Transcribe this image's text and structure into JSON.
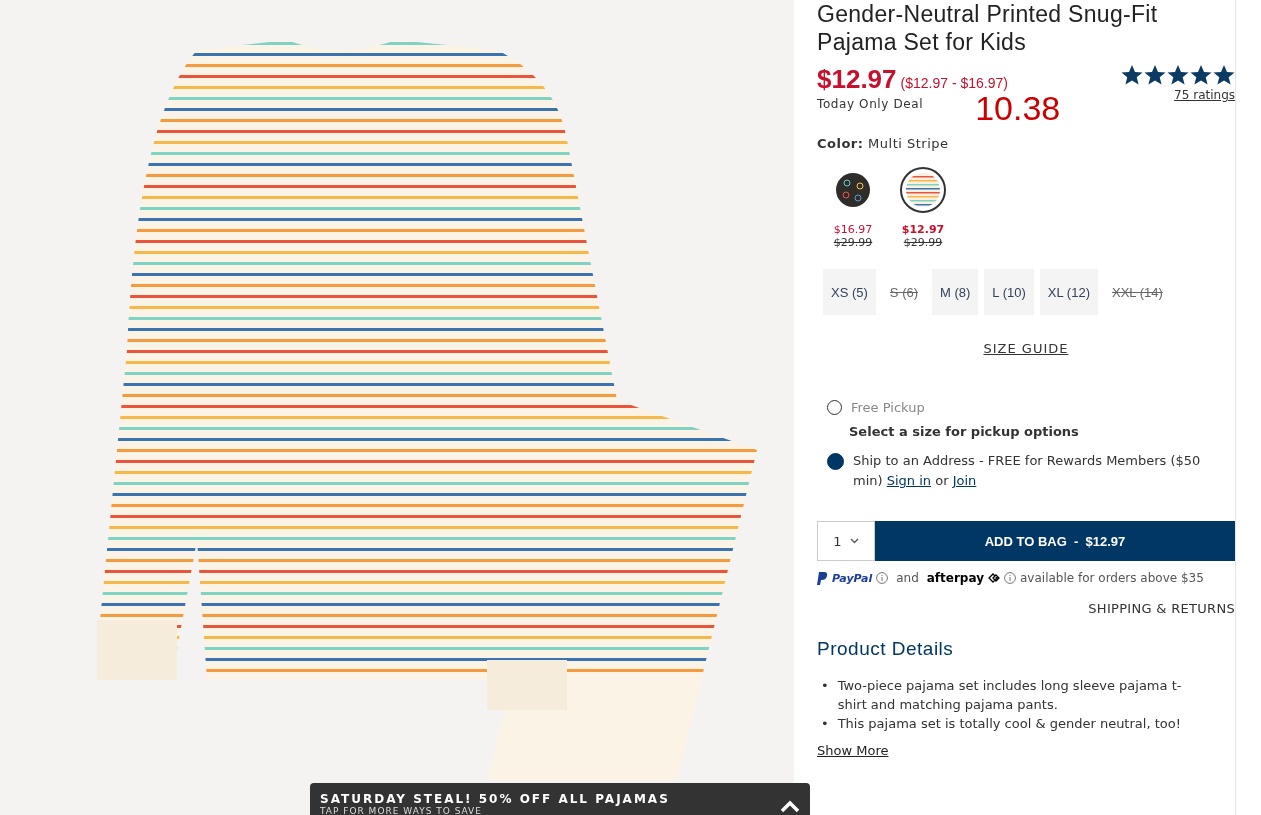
{
  "product_image": {
    "kind": "striped-pajamas"
  },
  "product": {
    "title": "Gender-Neutral Printed Snug-Fit Pajama Set for Kids",
    "price": "$12.97",
    "price_range": "($12.97 - $16.97)",
    "deal": "Today Only Deal",
    "overlay_price": "10.38",
    "rating": {
      "stars": 5,
      "label": "75 ratings"
    }
  },
  "color": {
    "label": "Color:",
    "value": "Multi Stripe",
    "swatches": [
      {
        "kind": "dark-print",
        "selected": false,
        "sale_price": "$16.97",
        "original_price": "$29.99"
      },
      {
        "kind": "stripe",
        "selected": true,
        "sale_price": "$12.97",
        "original_price": "$29.99"
      }
    ]
  },
  "sizes": [
    {
      "label": "XS (5)",
      "available": true
    },
    {
      "label": "S (6)",
      "available": false
    },
    {
      "label": "M (8)",
      "available": true
    },
    {
      "label": "L (10)",
      "available": true
    },
    {
      "label": "XL (12)",
      "available": true
    },
    {
      "label": "XXL (14)",
      "available": false
    }
  ],
  "size_guide": "SIZE GUIDE",
  "fulfillment": [
    {
      "label": "Free Pickup",
      "selected": false,
      "note": "Select a size for pickup options"
    },
    {
      "label": "Ship to an Address - FREE for Rewards Members ($50 min)",
      "selected": true,
      "links": [
        "Sign in",
        "Join"
      ],
      "joiner": "or"
    }
  ],
  "quantity": "1",
  "add_to_bag": "ADD TO BAG  -  $12.97",
  "payment": {
    "paypal": "PayPal",
    "and": "and",
    "afterpay": "afterpay",
    "note": "available for orders above $35"
  },
  "shipping_link": "SHIPPING & RETURNS",
  "details": {
    "heading": "Product Details",
    "marker": "•",
    "bullets": [
      "Two-piece pajama set includes long sleeve pajama t-shirt and matching pajama pants.",
      "This pajama set is totally cool & gender neutral, too!"
    ],
    "show_more": "Show More"
  },
  "promo_banner": {
    "title": "SATURDAY STEAL! 50% OFF ALL PAJAMAS",
    "subtitle": "TAP FOR MORE WAYS TO SAVE"
  }
}
